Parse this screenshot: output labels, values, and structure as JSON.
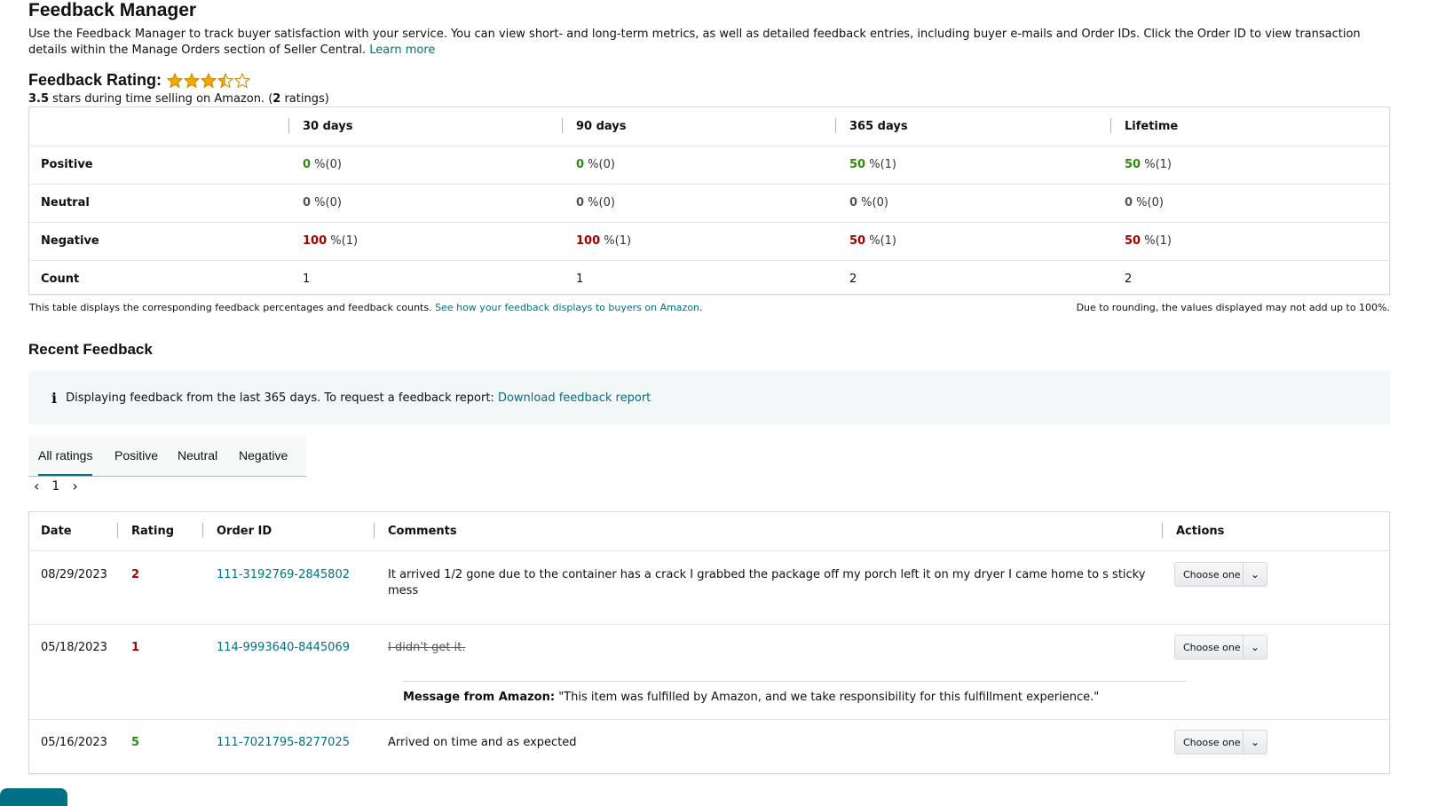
{
  "page": {
    "title": "Feedback Manager",
    "intro": "Use the Feedback Manager to track buyer satisfaction with your service. You can view short- and long-term metrics, as well as detailed feedback entries, including buyer e-mails and Order IDs. Click the Order ID to view transaction details within the Manage Orders section of Seller Central.",
    "learn_more": "Learn more"
  },
  "rating": {
    "heading": "Feedback Rating:",
    "stars_value": 3.5,
    "stars_max": 5,
    "star_color": "#f2a900",
    "summary_value": "3.5",
    "summary_text": "stars during time selling on Amazon. (",
    "summary_count": "2",
    "summary_suffix": "ratings)"
  },
  "metrics": {
    "columns": [
      "30 days",
      "90 days",
      "365 days",
      "Lifetime"
    ],
    "rows": [
      {
        "label": "Positive",
        "cells": [
          {
            "v": "0",
            "c": "(0)"
          },
          {
            "v": "0",
            "c": "(0)"
          },
          {
            "v": "50",
            "c": "(1)"
          },
          {
            "v": "50",
            "c": "(1)"
          }
        ]
      },
      {
        "label": "Neutral",
        "cells": [
          {
            "v": "0",
            "c": "(0)"
          },
          {
            "v": "0",
            "c": "(0)"
          },
          {
            "v": "0",
            "c": "(0)"
          },
          {
            "v": "0",
            "c": "(0)"
          }
        ]
      },
      {
        "label": "Negative",
        "cells": [
          {
            "v": "100",
            "c": "(1)"
          },
          {
            "v": "100",
            "c": "(1)"
          },
          {
            "v": "50",
            "c": "(1)"
          },
          {
            "v": "50",
            "c": "(1)"
          }
        ]
      }
    ],
    "count_label": "Count",
    "counts": [
      "1",
      "1",
      "2",
      "2"
    ],
    "pct_sign": "%",
    "positive_color": "#2e8b10",
    "negative_color": "#a30000",
    "note_left": "This table displays the corresponding feedback percentages and feedback counts.",
    "note_link": "See how your feedback displays to buyers on Amazon",
    "note_right": "Due to rounding, the values displayed may not add up to 100%."
  },
  "recent": {
    "title": "Recent Feedback",
    "info_icon": "i",
    "info_text": "Displaying feedback from the last 365 days. To request a feedback report:",
    "info_link": "Download feedback report",
    "tabs": [
      "All ratings",
      "Positive",
      "Neutral",
      "Negative"
    ],
    "active_tab": "All ratings",
    "page": "1",
    "columns": [
      "Date",
      "Rating",
      "Order ID",
      "Comments",
      "Actions"
    ],
    "action_label": "Choose one",
    "rows": [
      {
        "date": "08/29/2023",
        "rating": "2",
        "order": "111-3192769-2845802",
        "comment": "It arrived 1/2 gone due to the container has a crack I grabbed the package off my porch left it on my dryer I came home to s sticky mess"
      },
      {
        "date": "05/18/2023",
        "rating": "1",
        "order": "114-9993640-8445069",
        "comment": "I didn't get it.",
        "struck": true,
        "amazon_label": "Message from Amazon:",
        "amazon_message": "\"This item was fulfilled by Amazon, and we take responsibility for this fulfillment experience.\""
      },
      {
        "date": "05/16/2023",
        "rating": "5",
        "order": "111-7021795-8277025",
        "comment": "Arrived on time and as expected"
      }
    ]
  }
}
